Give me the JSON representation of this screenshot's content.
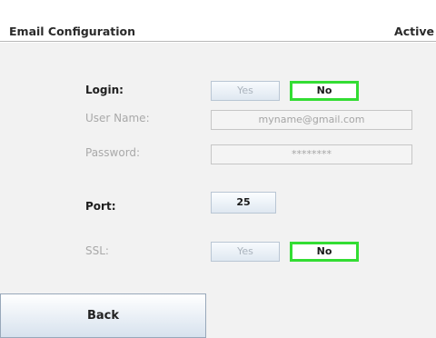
{
  "header": {
    "title": "Email Configuration",
    "status": "Active"
  },
  "form": {
    "login": {
      "label": "Login:",
      "yes": "Yes",
      "no": "No",
      "selected": "No"
    },
    "username": {
      "label": "User Name:",
      "value": "myname@gmail.com"
    },
    "password": {
      "label": "Password:",
      "value": "********"
    },
    "port": {
      "label": "Port:",
      "value": "25"
    },
    "ssl": {
      "label": "SSL:",
      "yes": "Yes",
      "no": "No",
      "selected": "No"
    }
  },
  "actions": {
    "back_label": "Back"
  },
  "colors": {
    "selected_border": "#33dd33",
    "panel_bg": "#f2f2f2"
  }
}
